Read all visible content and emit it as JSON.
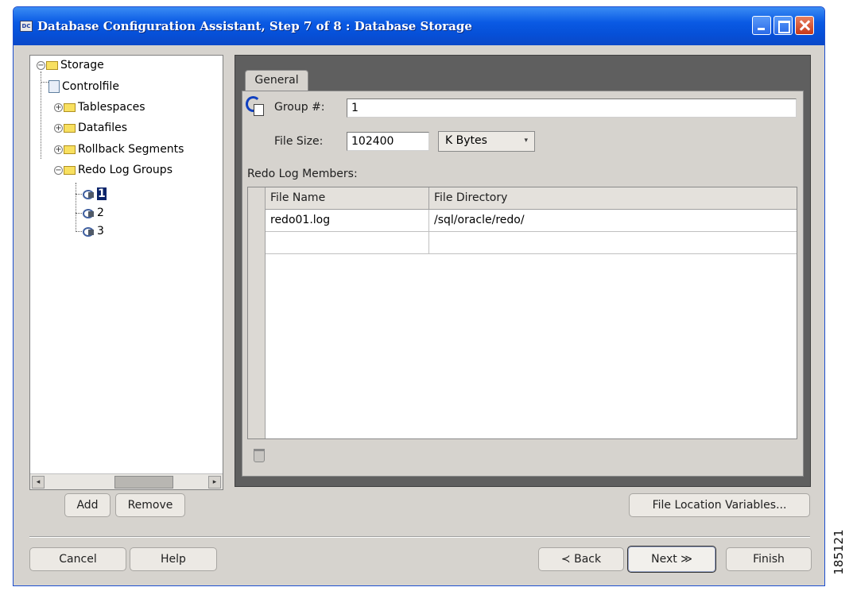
{
  "window": {
    "title": "Database Configuration Assistant, Step 7 of 8 : Database Storage",
    "app_icon_text": "DC"
  },
  "tree": {
    "root": "Storage",
    "items": [
      {
        "label": "Controlfile",
        "icon": "file-icon"
      },
      {
        "label": "Tablespaces",
        "icon": "folder-icon"
      },
      {
        "label": "Datafiles",
        "icon": "folder-icon"
      },
      {
        "label": "Rollback Segments",
        "icon": "folder-icon"
      },
      {
        "label": "Redo Log Groups",
        "icon": "folder-icon"
      }
    ],
    "redo_groups": [
      "1",
      "2",
      "3"
    ],
    "selected": "1",
    "scroll_left_glyph": "◂",
    "scroll_right_glyph": "▸"
  },
  "tabs": [
    {
      "label": "General",
      "active": true
    }
  ],
  "form": {
    "group_label": "Group #:",
    "group_value": "1",
    "file_size_label": "File Size:",
    "file_size_value": "102400",
    "units_value": "K Bytes",
    "units_arrow": "▾",
    "members_label": "Redo Log Members:"
  },
  "table": {
    "columns": [
      "File Name",
      "File Directory"
    ],
    "rows": [
      [
        "redo01.log",
        "/sql/oracle/redo/"
      ],
      [
        "",
        ""
      ]
    ]
  },
  "buttons": {
    "add": "Add",
    "remove": "Remove",
    "file_location_variables": "File Location Variables...",
    "cancel": "Cancel",
    "help": "Help",
    "back": "≺  Back",
    "next": "Next  ≫",
    "finish": "Finish"
  },
  "figure_id": "185121"
}
